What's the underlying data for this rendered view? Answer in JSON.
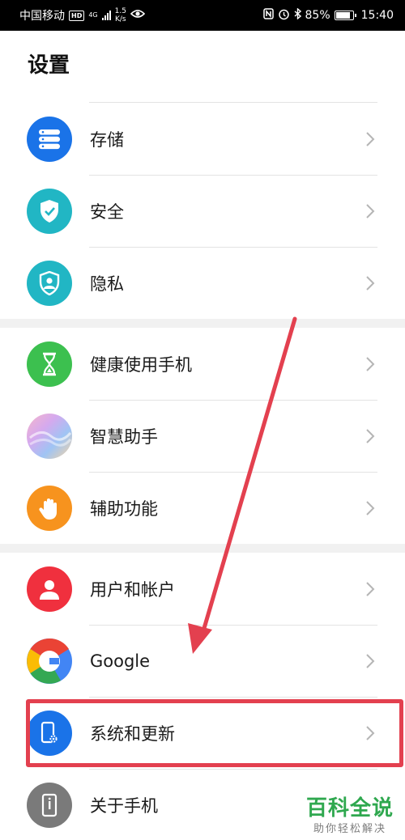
{
  "status_bar": {
    "carrier": "中国移动",
    "hd_badge": "HD",
    "network": "4G",
    "speed_value": "1.5",
    "speed_unit": "K/s",
    "battery": "85%",
    "time": "15:40",
    "icons": [
      "eye-icon",
      "nfc-icon",
      "alarm-icon",
      "bluetooth-icon",
      "battery-icon"
    ]
  },
  "page": {
    "title": "设置"
  },
  "settings": {
    "group1": [
      {
        "label": "存储",
        "icon": "storage-icon",
        "color": "#1a73e8"
      },
      {
        "label": "安全",
        "icon": "shield-check-icon",
        "color": "#21b6c4"
      },
      {
        "label": "隐私",
        "icon": "privacy-icon",
        "color": "#21b6c4"
      }
    ],
    "group2": [
      {
        "label": "健康使用手机",
        "icon": "hourglass-icon",
        "color": "#3cc04f"
      },
      {
        "label": "智慧助手",
        "icon": "assistant-icon",
        "color": "#c9a7ef"
      },
      {
        "label": "辅助功能",
        "icon": "hand-icon",
        "color": "#f7931e"
      }
    ],
    "group3": [
      {
        "label": "用户和帐户",
        "icon": "user-icon",
        "color": "#f0303e"
      },
      {
        "label": "Google",
        "icon": "google-icon",
        "color": "#4285f4"
      },
      {
        "label": "系统和更新",
        "icon": "system-update-icon",
        "color": "#1a73e8"
      },
      {
        "label": "关于手机",
        "icon": "phone-info-icon",
        "color": "#7a7a7a"
      }
    ]
  },
  "annotation": {
    "color": "#e3404f"
  },
  "watermark": {
    "main": "百科全说",
    "sub": "助你轻松解决",
    "color": "#2fa84f"
  }
}
